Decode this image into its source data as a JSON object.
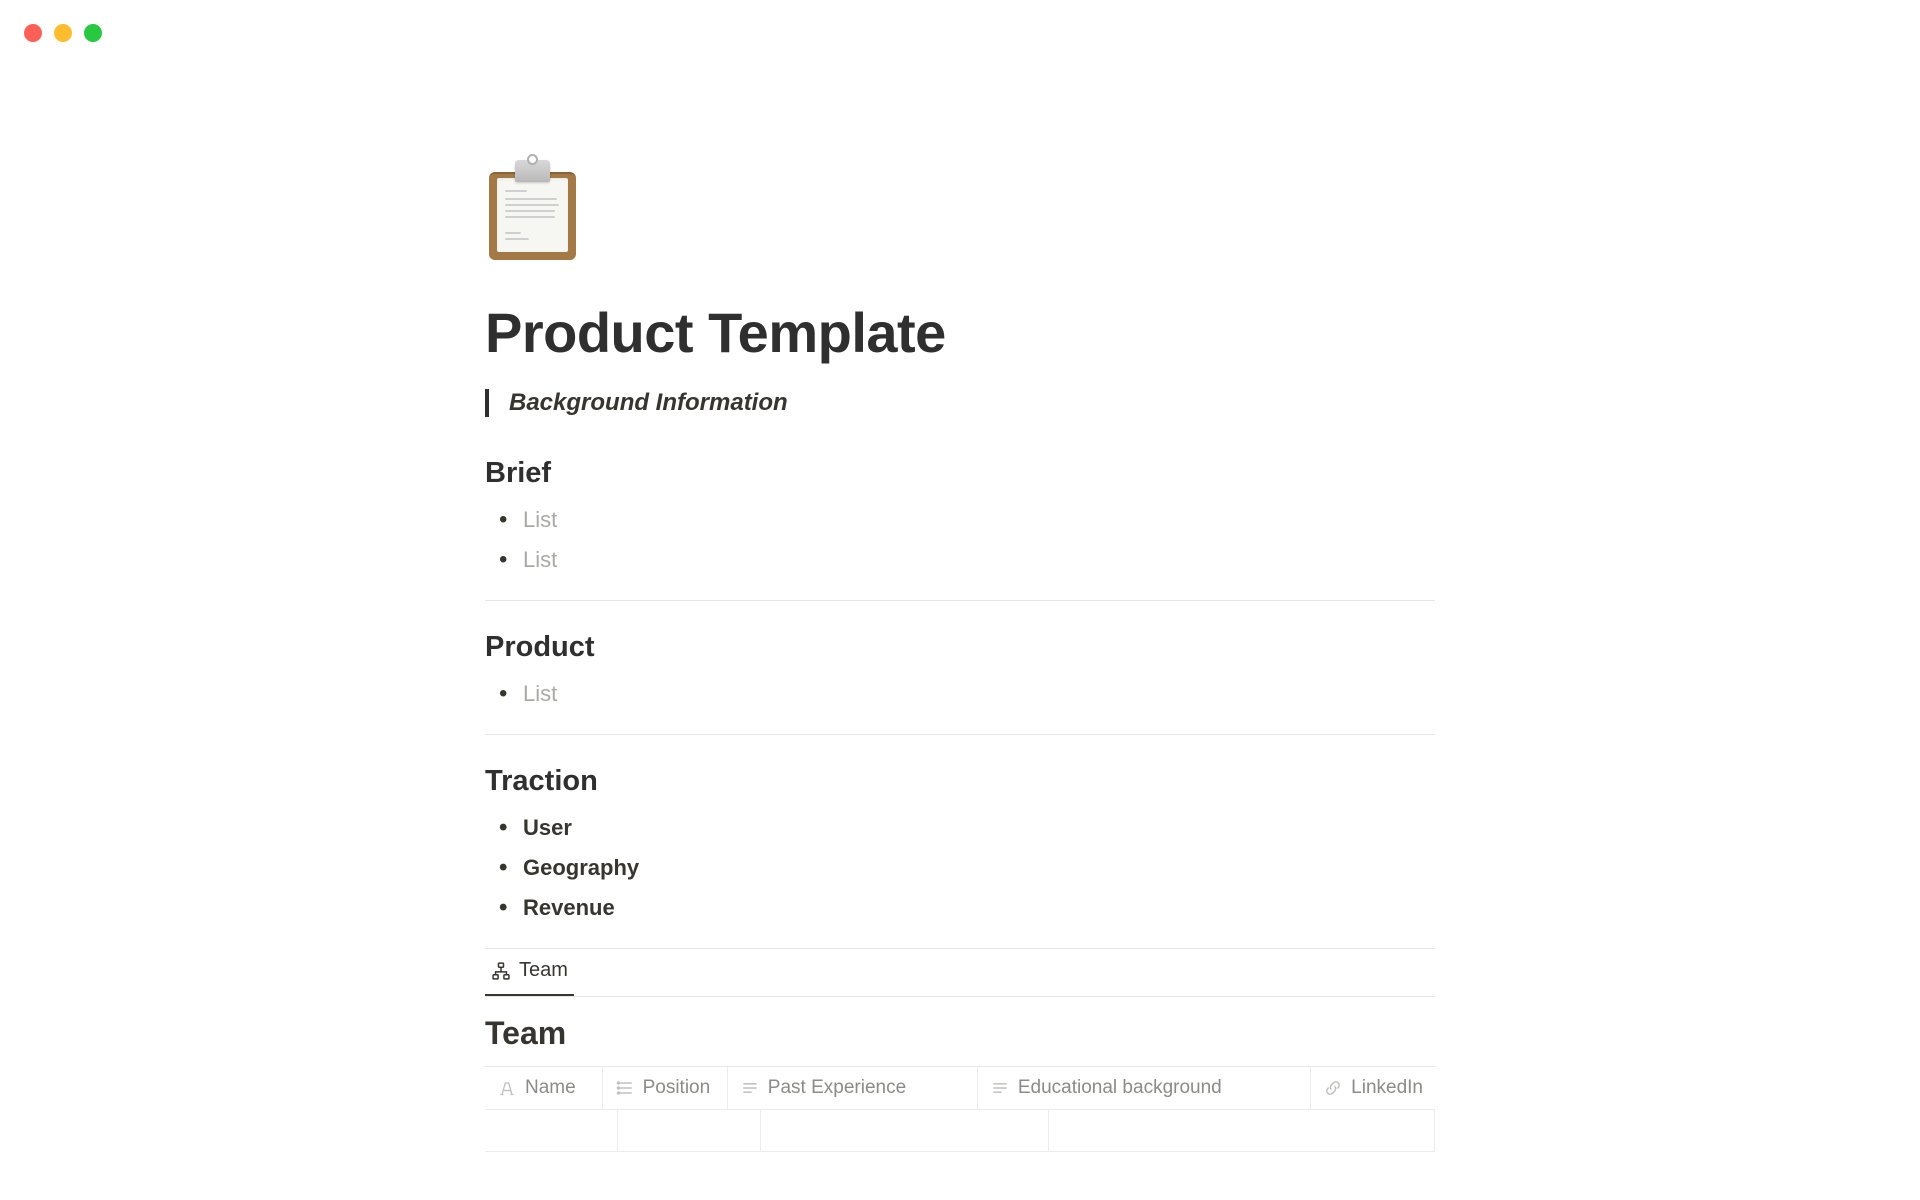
{
  "page": {
    "title": "Product Template",
    "quote": "Background Information"
  },
  "sections": {
    "brief": {
      "title": "Brief",
      "items": [
        "List",
        "List"
      ]
    },
    "product": {
      "title": "Product",
      "items": [
        "List"
      ]
    },
    "traction": {
      "title": "Traction",
      "items": [
        "User",
        "Geography",
        "Revenue"
      ]
    }
  },
  "database": {
    "tab_label": "Team",
    "title": "Team",
    "columns": {
      "name": "Name",
      "position": "Position",
      "past": "Past Experience",
      "edu": "Educational background",
      "linkedin": "LinkedIn"
    }
  }
}
